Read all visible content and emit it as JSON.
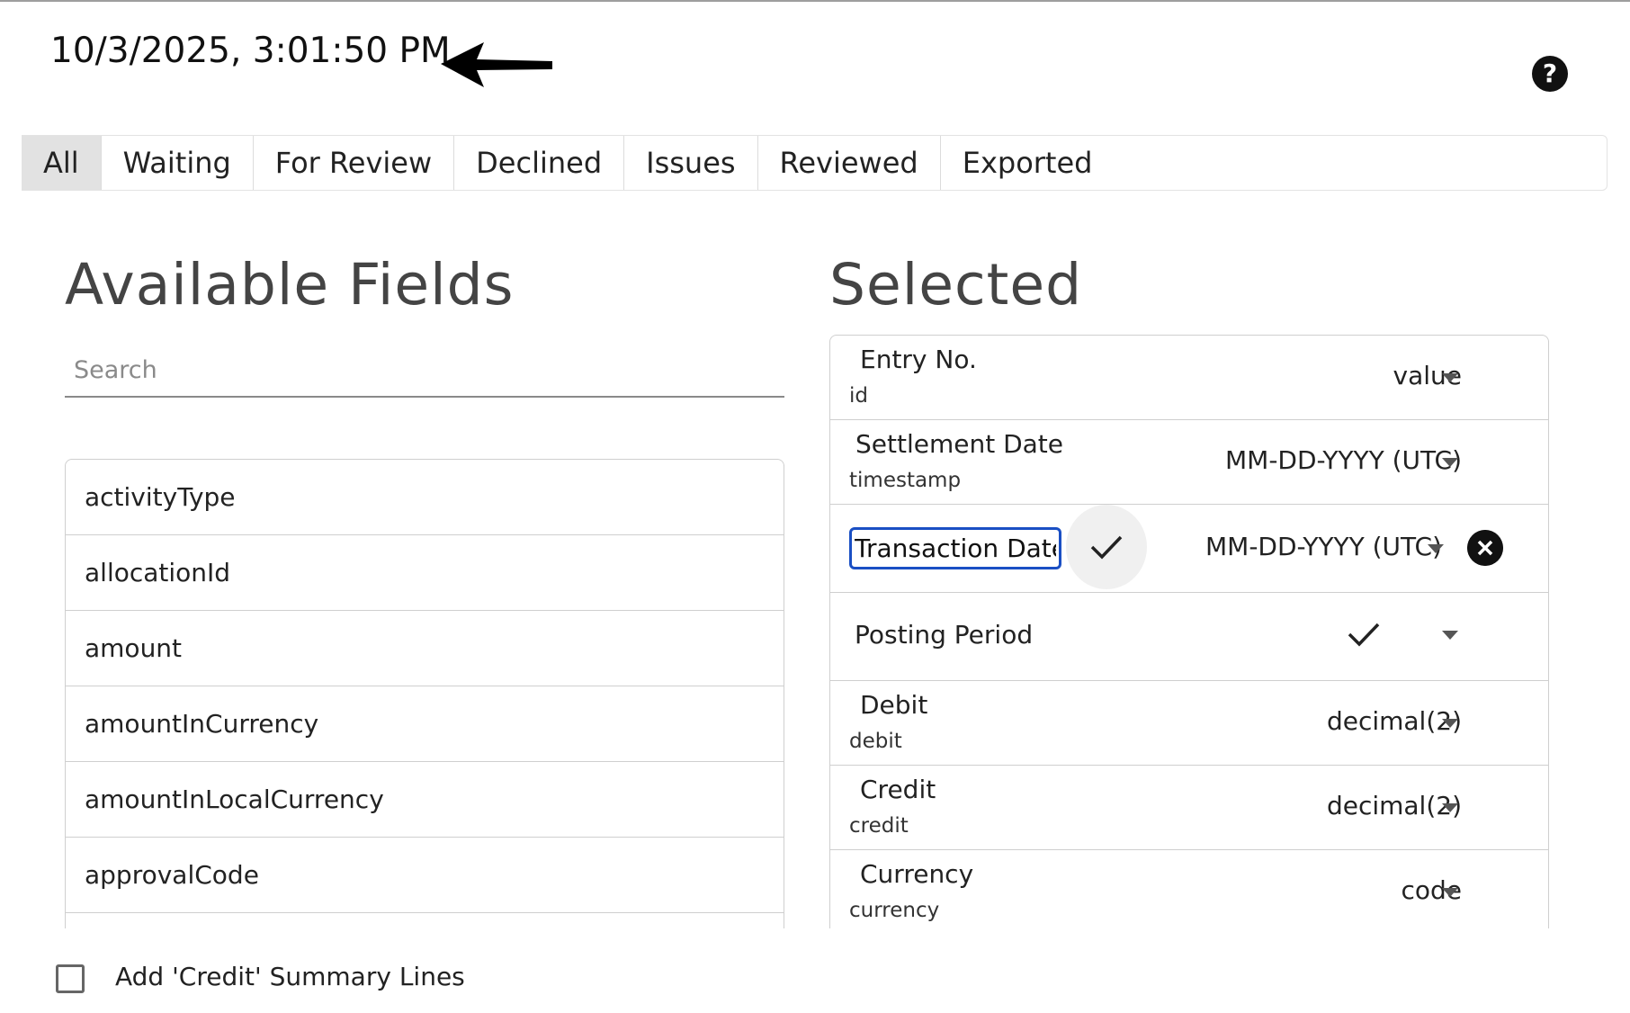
{
  "header": {
    "timestamp": "10/3/2025, 3:01:50 PM",
    "arrow_icon": "left-arrow-icon",
    "help_icon": "question-circle-icon",
    "help_glyph": "?"
  },
  "tabs": [
    {
      "label": "All",
      "active": true
    },
    {
      "label": "Waiting",
      "active": false
    },
    {
      "label": "For Review",
      "active": false
    },
    {
      "label": "Declined",
      "active": false
    },
    {
      "label": "Issues",
      "active": false
    },
    {
      "label": "Reviewed",
      "active": false
    },
    {
      "label": "Exported",
      "active": false
    }
  ],
  "available": {
    "title": "Available Fields",
    "search_placeholder": "Search",
    "items": [
      "activityType",
      "allocationId",
      "amount",
      "amountInCurrency",
      "amountInLocalCurrency",
      "approvalCode"
    ]
  },
  "selected": {
    "title": "Selected",
    "rows": [
      {
        "label": "Entry No.",
        "key": "id",
        "format": "value"
      },
      {
        "label": "Settlement Date",
        "key": "timestamp",
        "format": "MM-DD-YYYY (UTC)"
      },
      {
        "edit_value": "Transaction Date",
        "format": "MM-DD-YYYY (UTC)"
      },
      {
        "label": "Posting Period",
        "format": ""
      },
      {
        "label": "Debit",
        "key": "debit",
        "format": "decimal(2)"
      },
      {
        "label": "Credit",
        "key": "credit",
        "format": "decimal(2)"
      },
      {
        "label": "Currency",
        "key": "currency",
        "format": "code"
      }
    ]
  },
  "footer": {
    "checkbox_label": "Add 'Credit' Summary Lines",
    "checked": false
  },
  "colors": {
    "accent_focus": "#1a4fc4",
    "active_tab_bg": "#e2e2e2",
    "border": "#cfcfcf"
  }
}
